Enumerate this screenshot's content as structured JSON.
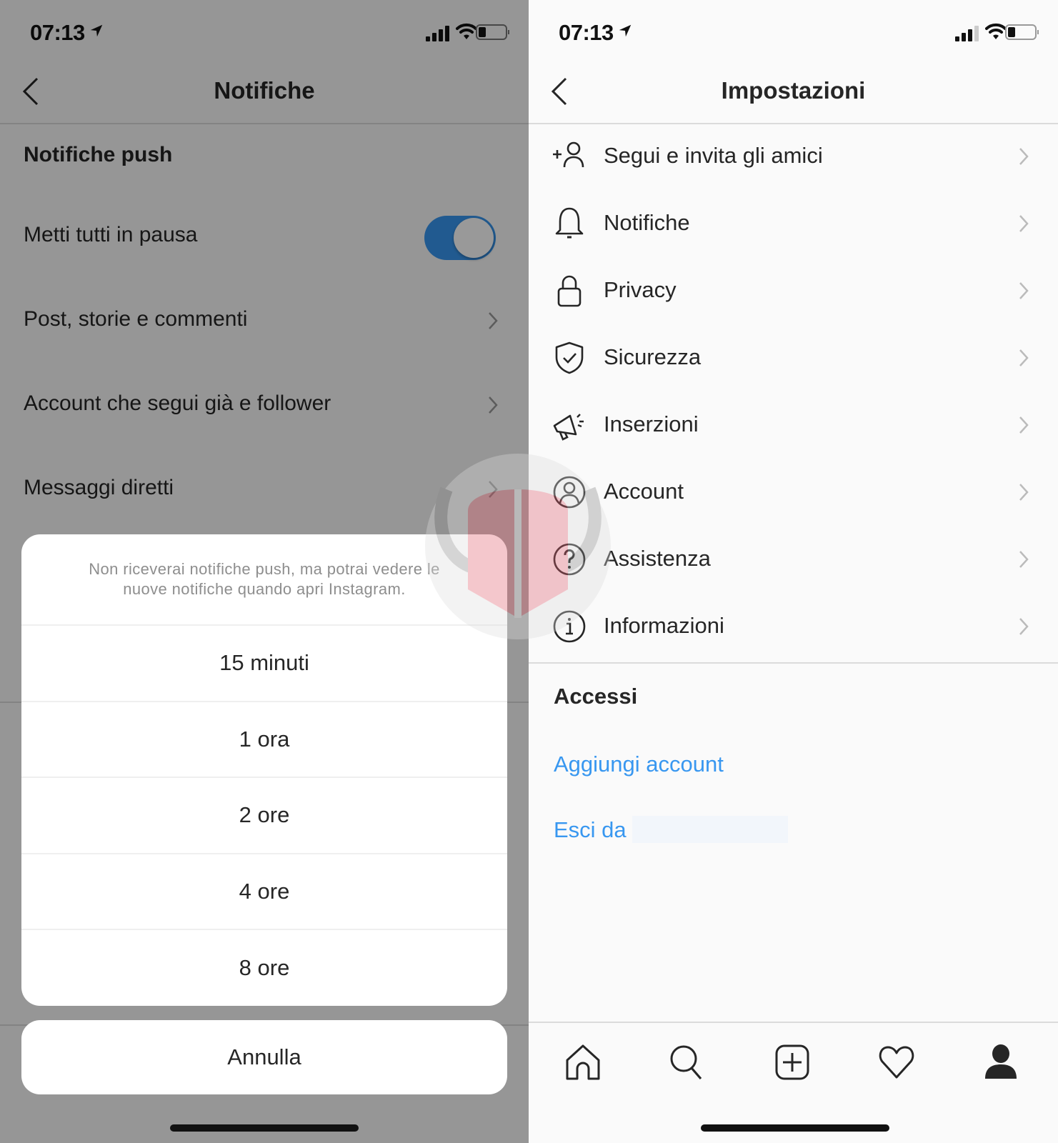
{
  "left_screen": {
    "status_bar": {
      "time": "07:13",
      "signal_bars": 4,
      "battery_level": 0.25
    },
    "header": {
      "title": "Notifiche",
      "back_icon": "chevron-left-icon"
    },
    "section_title": "Notifiche push",
    "pause_all": {
      "label": "Metti tutti in pausa",
      "toggle_on": true
    },
    "rows": [
      {
        "label": "Post, storie e commenti"
      },
      {
        "label": "Account che segui già e follower"
      },
      {
        "label": "Messaggi diretti"
      }
    ],
    "action_sheet": {
      "message": "Non riceverai notifiche push, ma potrai vedere le nuove notifiche quando apri Instagram.",
      "options": [
        {
          "label": "15 minuti"
        },
        {
          "label": "1 ora"
        },
        {
          "label": "2 ore"
        },
        {
          "label": "4 ore"
        },
        {
          "label": "8 ore"
        }
      ],
      "cancel_label": "Annulla"
    }
  },
  "right_screen": {
    "status_bar": {
      "time": "07:13",
      "signal_bars": 3,
      "battery_level": 0.25
    },
    "header": {
      "title": "Impostazioni",
      "back_icon": "chevron-left-icon"
    },
    "menu": [
      {
        "label": "Segui e invita gli amici",
        "icon": "add-person-icon"
      },
      {
        "label": "Notifiche",
        "icon": "bell-icon"
      },
      {
        "label": "Privacy",
        "icon": "lock-icon"
      },
      {
        "label": "Sicurezza",
        "icon": "shield-check-icon"
      },
      {
        "label": "Inserzioni",
        "icon": "megaphone-icon"
      },
      {
        "label": "Account",
        "icon": "user-circle-icon"
      },
      {
        "label": "Assistenza",
        "icon": "help-circle-icon"
      },
      {
        "label": "Informazioni",
        "icon": "info-circle-icon"
      }
    ],
    "logins": {
      "title": "Accessi",
      "add_account": "Aggiungi account",
      "logout_prefix": "Esci da"
    },
    "tab_bar": [
      {
        "name": "home",
        "icon": "home-icon"
      },
      {
        "name": "search",
        "icon": "search-icon"
      },
      {
        "name": "new-post",
        "icon": "add-post-icon"
      },
      {
        "name": "activity",
        "icon": "heart-icon"
      },
      {
        "name": "profile",
        "icon": "profile-icon"
      }
    ]
  },
  "colors": {
    "accent_blue": "#3897f0",
    "text_primary": "#262626",
    "text_secondary": "#8e8e8e",
    "separator": "#dbdbdb"
  }
}
